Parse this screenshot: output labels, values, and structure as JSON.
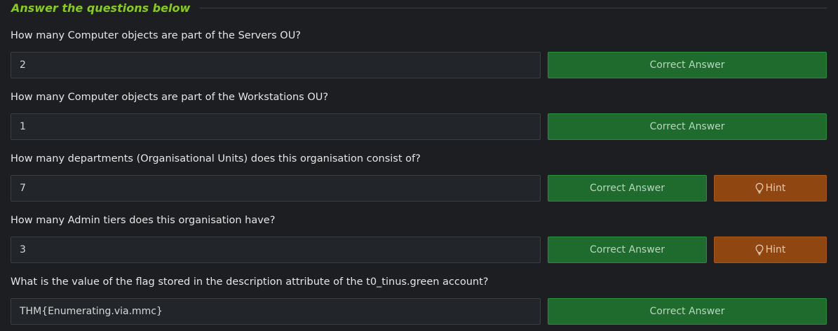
{
  "section": {
    "title": "Answer the questions below"
  },
  "questions": [
    {
      "text": "How many Computer objects are part of the Servers OU?",
      "answer": "2",
      "button_label": "Correct Answer"
    },
    {
      "text": "How many Computer objects are part of the Workstations OU?",
      "answer": "1",
      "button_label": "Correct Answer"
    },
    {
      "text": "How many departments (Organisational Units) does this organisation consist of?",
      "answer": "7",
      "button_label": "Correct Answer",
      "hint_label": "Hint"
    },
    {
      "text": "How many Admin tiers does this organisation have?",
      "answer": "3",
      "button_label": "Correct Answer",
      "hint_label": "Hint"
    },
    {
      "text": "What is the value of the flag stored in the description attribute of the t0_tinus.green account?",
      "answer": "THM{Enumerating.via.mmc}",
      "button_label": "Correct Answer"
    }
  ],
  "colors": {
    "title": "#88cc14",
    "correct_button": "#1f6b2e",
    "hint_button": "#8f4610",
    "background": "#1c1e21"
  },
  "icons": {
    "hint": "lightbulb-icon"
  }
}
